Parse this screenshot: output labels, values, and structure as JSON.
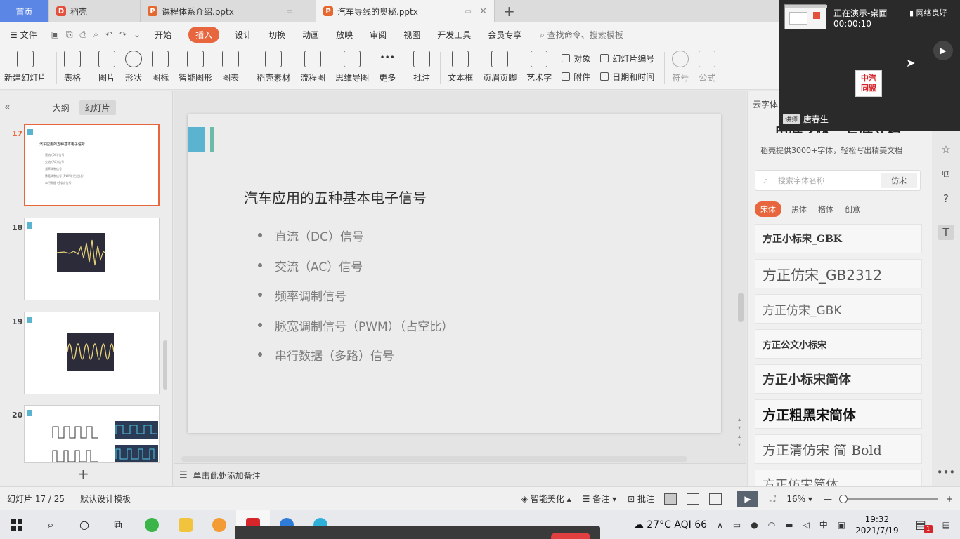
{
  "tabs": {
    "home": "首页",
    "items": [
      {
        "label": "稻壳",
        "icon": "docer-icon"
      },
      {
        "label": "课程体系介绍.pptx",
        "icon": "ppt-icon"
      },
      {
        "label": "汽车导线的奥秘.pptx",
        "icon": "ppt-icon"
      }
    ],
    "add": "+"
  },
  "menu": {
    "file": "文件",
    "items": [
      "开始",
      "插入",
      "设计",
      "切换",
      "动画",
      "放映",
      "审阅",
      "视图",
      "开发工具",
      "会员专享"
    ],
    "active_index": 1,
    "search": "查找命令、搜索模板"
  },
  "ribbon": {
    "large_buttons": [
      "新建幻灯片",
      "表格",
      "图片",
      "形状",
      "图标",
      "智能图形",
      "图表",
      "稻壳素材",
      "流程图",
      "思维导图",
      "更多",
      "批注",
      "文本框",
      "页眉页脚",
      "艺术字"
    ],
    "small_col1": [
      "对象",
      "附件"
    ],
    "small_col2": [
      "幻灯片编号",
      "日期和时间"
    ],
    "dim_buttons": [
      "符号",
      "公式"
    ]
  },
  "left_panel": {
    "tabs": [
      "大纲",
      "幻灯片"
    ],
    "active_tab": 1,
    "thumbnails": [
      {
        "number": "17",
        "active": true,
        "title": "汽车应用的五种基本电子信号",
        "lines": [
          "直流 (DC) 信号",
          "交流 (AC) 信号",
          "频率调制信号",
          "脉宽调制信号 (PWM) (占空比)",
          "串行数据 (多路) 信号"
        ]
      },
      {
        "number": "18",
        "active": false
      },
      {
        "number": "19",
        "active": false
      },
      {
        "number": "20",
        "active": false
      }
    ],
    "add": "+"
  },
  "slide": {
    "title": "汽车应用的五种基本电子信号",
    "bullets": [
      "直流（DC）信号",
      "交流（AC）信号",
      "频率调制信号",
      "脉宽调制信号（PWM）（占空比）",
      "串行数据（多路）信号"
    ],
    "accent": "#5ab4d0"
  },
  "notes": {
    "placeholder": "单击此处添加备注"
  },
  "right_panel": {
    "header": "云字体",
    "slogan": "用好字体，写好文档",
    "subtitle": "稻壳提供3000+字体，轻松写出精美文档",
    "search_placeholder": "搜索字体名称",
    "search_button": "仿宋",
    "filters": [
      "宋体",
      "黑体",
      "楷体",
      "创意"
    ],
    "active_filter": 0,
    "fonts": [
      "方正小标宋_GBK",
      "方正仿宋_GB2312",
      "方正仿宋_GBK",
      "方正公文小标宋",
      "方正小标宋简体",
      "方正粗黑宋简体",
      "方正清仿宋 简 Bold",
      "方正仿宋简体"
    ]
  },
  "conference": {
    "status": "正在演示-桌面",
    "timer": "00:00:10",
    "network": "网络良好",
    "logo_line1": "中汽",
    "logo_line2": "同盟",
    "speaker_badge": "讲师",
    "speaker_name": "唐春生"
  },
  "statusbar": {
    "slide_counter": "幻灯片 17 / 25",
    "template": "默认设计模板",
    "beautify": "智能美化",
    "notes": "备注",
    "comments": "批注",
    "zoom": "16%"
  },
  "taskbar": {
    "weather": "27°C  AQI 66",
    "time": "19:32",
    "date": "2021/7/19",
    "ime": "中",
    "notifications": "1"
  }
}
